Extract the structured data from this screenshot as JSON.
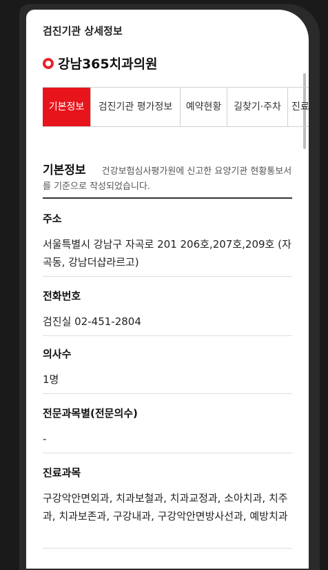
{
  "header": {
    "title": "검진기관 상세정보"
  },
  "org": {
    "name": "강남365치과의원",
    "icon": "location-pin-icon"
  },
  "tabs": [
    {
      "label": "기본정보",
      "active": true
    },
    {
      "label": "검진기관 평가정보",
      "active": false
    },
    {
      "label": "예약현황",
      "active": false
    },
    {
      "label": "길찾기·주차",
      "active": false
    },
    {
      "label": "진료",
      "active": false
    }
  ],
  "section": {
    "title": "기본정보",
    "description": "건강보험심사평가원에 신고한 요양기관 현황통보서를 기준으로 작성되었습니다."
  },
  "fields": [
    {
      "label": "주소",
      "value": "서울특별시 강남구 자곡로 201 206호,207호,209호 (자곡동, 강남더샵라르고)"
    },
    {
      "label": "전화번호",
      "value": "검진실 02-451-2804"
    },
    {
      "label": "의사수",
      "value": "1명"
    },
    {
      "label": "전문과목별(전문의수)",
      "value": "-"
    },
    {
      "label": "진료과목",
      "value": "구강악안면외과, 치과보철과, 치과교정과, 소아치과, 치주과, 치과보존과, 구강내과, 구강악안면방사선과, 예방치과"
    }
  ],
  "colors": {
    "accent": "#e8141b",
    "text": "#222222",
    "divider": "#dedede"
  }
}
